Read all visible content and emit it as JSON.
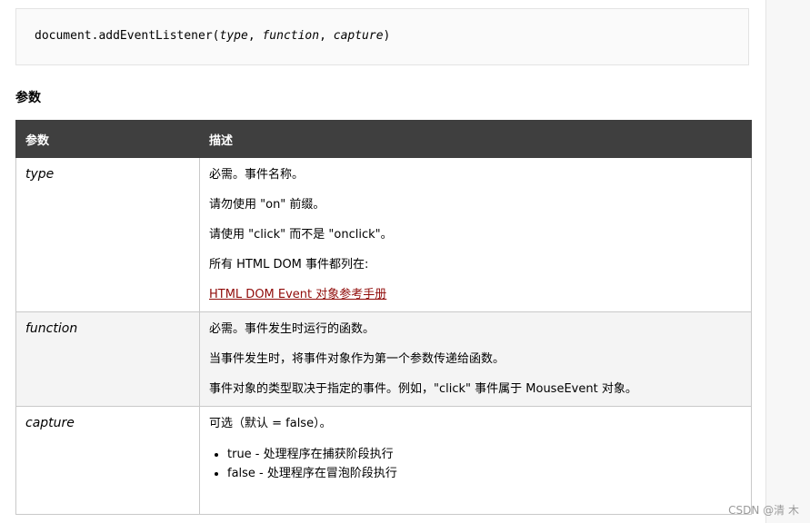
{
  "code": {
    "prefix": "document.addEventListener(",
    "arg_type": "type",
    "sep1": ", ",
    "arg_function": "function",
    "sep2": ", ",
    "arg_capture": "capture",
    "suffix": ")"
  },
  "section_heading": "参数",
  "table": {
    "headers": {
      "param": "参数",
      "desc": "描述"
    },
    "rows": [
      {
        "name": "type",
        "lines": [
          "必需。事件名称。",
          "请勿使用 \"on\" 前缀。",
          "请使用 \"click\" 而不是 \"onclick\"。",
          "所有 HTML DOM 事件都列在:"
        ],
        "link": "HTML DOM Event 对象参考手册"
      },
      {
        "name": "function",
        "lines": [
          "必需。事件发生时运行的函数。",
          "当事件发生时，将事件对象作为第一个参数传递给函数。",
          "事件对象的类型取决于指定的事件。例如，\"click\" 事件属于 MouseEvent 对象。"
        ]
      },
      {
        "name": "capture",
        "lines": [
          "可选（默认 = false）。"
        ],
        "bullets": [
          "true - 处理程序在捕获阶段执行",
          "false - 处理程序在冒泡阶段执行"
        ]
      }
    ]
  },
  "watermark": "CSDN @清 木"
}
